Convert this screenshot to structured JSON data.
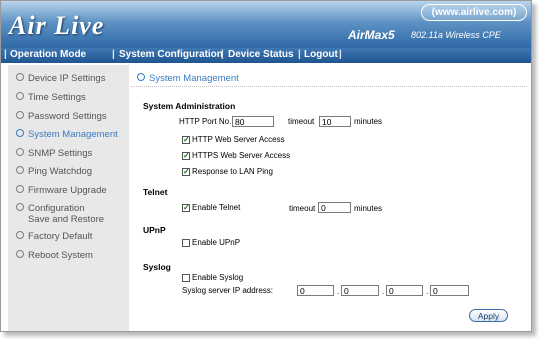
{
  "header": {
    "logo": "Air Live",
    "url": "(www.airlive.com)",
    "model": "AirMax5",
    "model_desc": "802.11a Wireless CPE"
  },
  "menu": {
    "items": [
      "Operation Mode",
      "System Configuration",
      "Device Status",
      "Logout"
    ]
  },
  "sidebar": {
    "items": [
      {
        "label": "Device IP Settings"
      },
      {
        "label": "Time Settings"
      },
      {
        "label": "Password Settings"
      },
      {
        "label": "System Management"
      },
      {
        "label": "SNMP Settings"
      },
      {
        "label": "Ping Watchdog"
      },
      {
        "label": "Firmware Upgrade"
      },
      {
        "label": "Configuration",
        "label2": "Save and Restore"
      },
      {
        "label": "Factory Default"
      },
      {
        "label": "Reboot System"
      }
    ],
    "active": "System Management"
  },
  "main": {
    "title": "System Management",
    "system_admin": {
      "heading": "System Administration",
      "http_port_label": "HTTP Port No.",
      "http_port_value": "80",
      "timeout_label": "timeout",
      "timeout_value": "10",
      "minutes_label": "minutes",
      "http_access": {
        "label": "HTTP Web Server Access",
        "checked": true
      },
      "https_access": {
        "label": "HTTPS Web Server Access",
        "checked": true
      },
      "lan_ping": {
        "label": "Response to LAN Ping",
        "checked": true
      }
    },
    "telnet": {
      "heading": "Telnet",
      "enable": {
        "label": "Enable Telnet",
        "checked": true
      },
      "timeout_label": "timeout",
      "timeout_value": "0",
      "minutes_label": "minutes"
    },
    "upnp": {
      "heading": "UPnP",
      "enable": {
        "label": "Enable UPnP",
        "checked": false
      }
    },
    "syslog": {
      "heading": "Syslog",
      "enable": {
        "label": "Enable Syslog",
        "checked": false
      },
      "ip_label": "Syslog server IP address:",
      "ip": [
        "0",
        "0",
        "0",
        "0"
      ],
      "dot": "."
    },
    "apply_label": "Apply"
  },
  "colors": {
    "header_dark": "#2f68a6",
    "header_light": "#b9d4ec",
    "accent": "#3a7bc0",
    "sidebar_bg": "#e8e8e8"
  }
}
